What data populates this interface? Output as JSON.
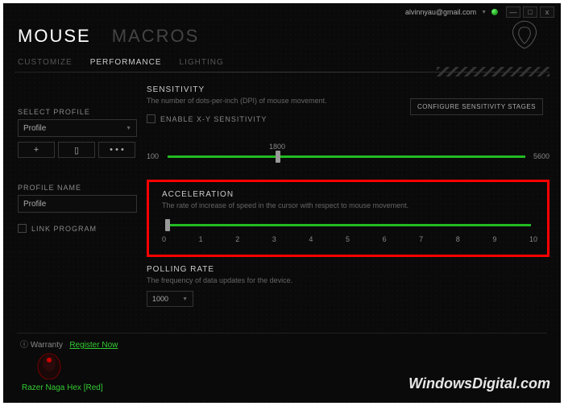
{
  "header": {
    "user_email": "alvinnyau@gmail.com",
    "min": "—",
    "max": "□",
    "close": "x"
  },
  "tabs": {
    "mouse": "MOUSE",
    "macros": "MACROS"
  },
  "subtabs": {
    "customize": "CUSTOMIZE",
    "performance": "PERFORMANCE",
    "lighting": "LIGHTING"
  },
  "sidebar": {
    "select_profile_label": "SELECT PROFILE",
    "profile_value": "Profile",
    "add": "+",
    "delete": "🗑",
    "more": "• • •",
    "profile_name_label": "PROFILE NAME",
    "profile_name_value": "Profile",
    "link_program": "LINK PROGRAM"
  },
  "sensitivity": {
    "title": "SENSITIVITY",
    "desc": "The number of dots-per-inch (DPI) of mouse movement.",
    "enable_xy": "ENABLE X-Y SENSITIVITY",
    "configure_btn": "CONFIGURE SENSITIVITY STAGES",
    "min": "100",
    "max": "5600",
    "value": "1800"
  },
  "acceleration": {
    "title": "ACCELERATION",
    "desc": "The rate of increase of speed in the cursor with respect to mouse movement.",
    "ticks": [
      "0",
      "1",
      "2",
      "3",
      "4",
      "5",
      "6",
      "7",
      "8",
      "9",
      "10"
    ]
  },
  "polling": {
    "title": "POLLING RATE",
    "desc": "The frequency of data updates for the device.",
    "value": "1000"
  },
  "footer": {
    "warranty_label": "Warranty",
    "register": "Register Now",
    "device": "Razer Naga Hex [Red]"
  },
  "watermark": "WindowsDigital.com"
}
